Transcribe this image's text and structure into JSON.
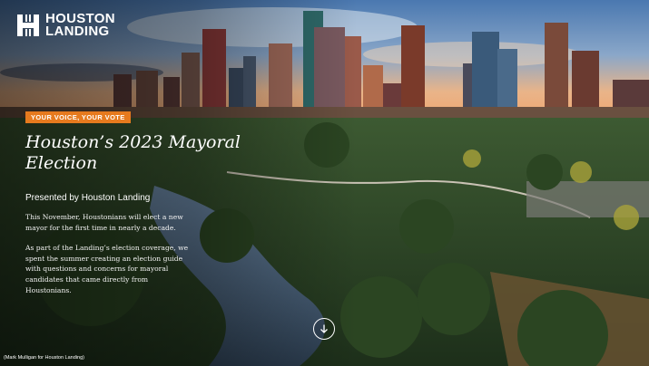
{
  "brand": {
    "line1": "HOUSTON",
    "line2": "LANDING",
    "logo_icon": "houston-landing-h-logo"
  },
  "hero": {
    "tag": "YOUR VOICE, YOUR VOTE",
    "title": "Houston’s 2023 Mayoral Election",
    "byline": "Presented by Houston Landing",
    "paragraphs": [
      "This November, Houstonians will elect a new mayor for the first time in nearly a decade.",
      "As part of the Landing’s election coverage, we spent the summer creating an election guide with questions and concerns for mayoral candidates that came directly from Houstonians."
    ],
    "scroll_icon": "arrow-down-circle-icon"
  },
  "photo_credit": "(Mark Mulligan for Houston Landing)",
  "colors": {
    "tag_bg": "#e67a1e",
    "text": "#ffffff"
  }
}
